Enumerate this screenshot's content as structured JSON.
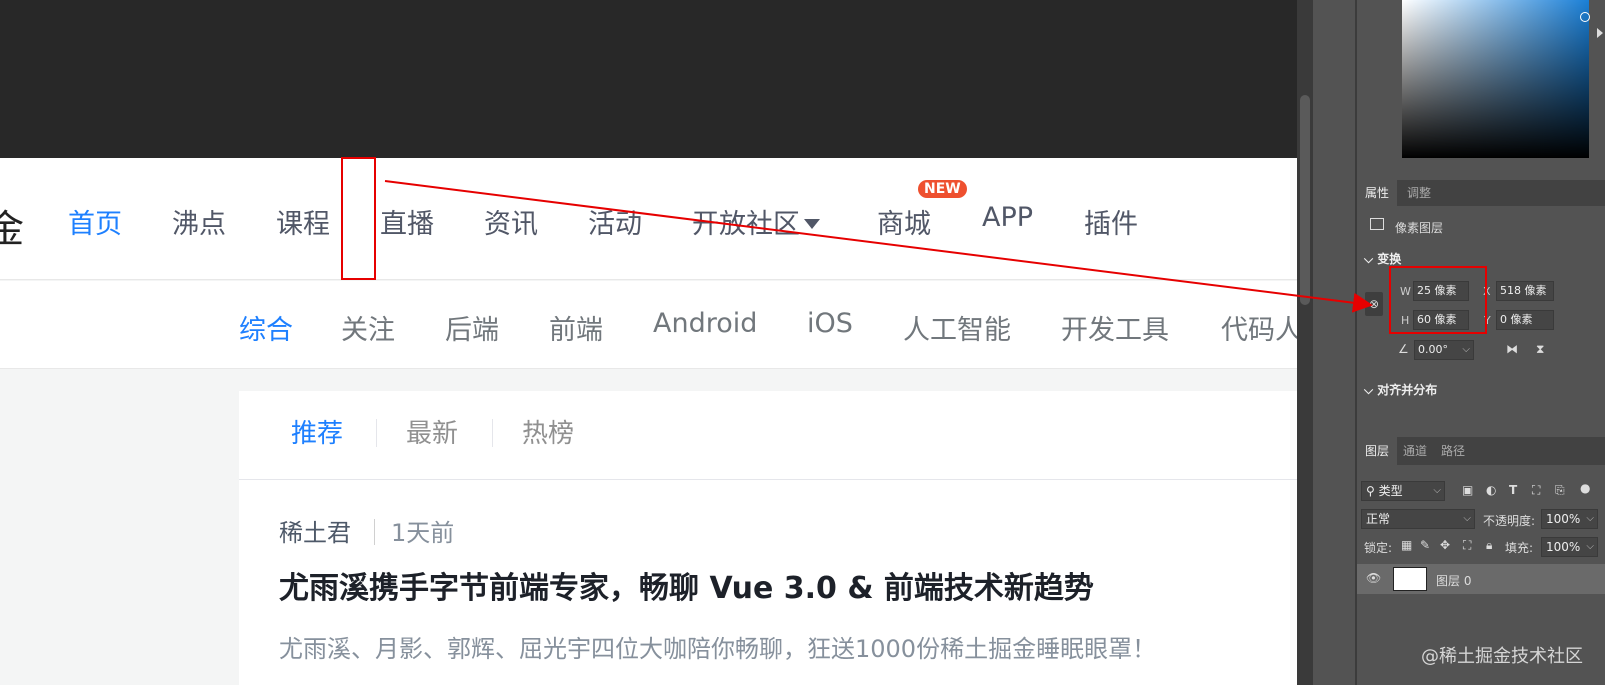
{
  "top_nav": {
    "logo_fragment": "金",
    "items": [
      "首页",
      "沸点",
      "课程",
      "直播",
      "资讯",
      "活动",
      "开放社区",
      "商城",
      "APP",
      "插件"
    ],
    "badge": "NEW"
  },
  "category_nav": {
    "items": [
      "综合",
      "关注",
      "后端",
      "前端",
      "Android",
      "iOS",
      "人工智能",
      "开发工具",
      "代码人"
    ]
  },
  "feed": {
    "tabs": [
      "推荐",
      "最新",
      "热榜"
    ],
    "article": {
      "author": "稀土君",
      "time": "1天前",
      "title": "尤雨溪携手字节前端专家，畅聊 Vue 3.0 & 前端技术新趋势",
      "abstract": "尤雨溪、月影、郭辉、屈光宇四位大咖陪你畅聊，狂送1000份稀土掘金睡眠眼罩！"
    }
  },
  "ps_panel": {
    "props_tabs": [
      "属性",
      "调整"
    ],
    "layer_kind": "像素图层",
    "transform_title": "变换",
    "w_label": "W",
    "w_value": "25 像素",
    "h_label": "H",
    "h_value": "60 像素",
    "x_label": "X",
    "x_value": "518 像素",
    "y_label": "Y",
    "y_value": "0 像素",
    "angle_value": "0.00°",
    "align_title": "对齐并分布",
    "layers_tabs": [
      "图层",
      "通道",
      "路径"
    ],
    "filter_select": "类型",
    "blend_mode": "正常",
    "opacity_label": "不透明度:",
    "opacity_value": "100%",
    "lock_label": "锁定:",
    "fill_label": "填充:",
    "fill_value": "100%",
    "layer_name": "图层 0"
  },
  "watermark": "@稀土掘金技术社区",
  "colors": {
    "accent": "#1e80ff",
    "annotation": "#e60000",
    "badge": "#ee502f"
  },
  "icons": [
    "eye-icon",
    "link-icon",
    "search-icon",
    "flip-h-icon",
    "flip-v-icon",
    "angle-icon"
  ]
}
